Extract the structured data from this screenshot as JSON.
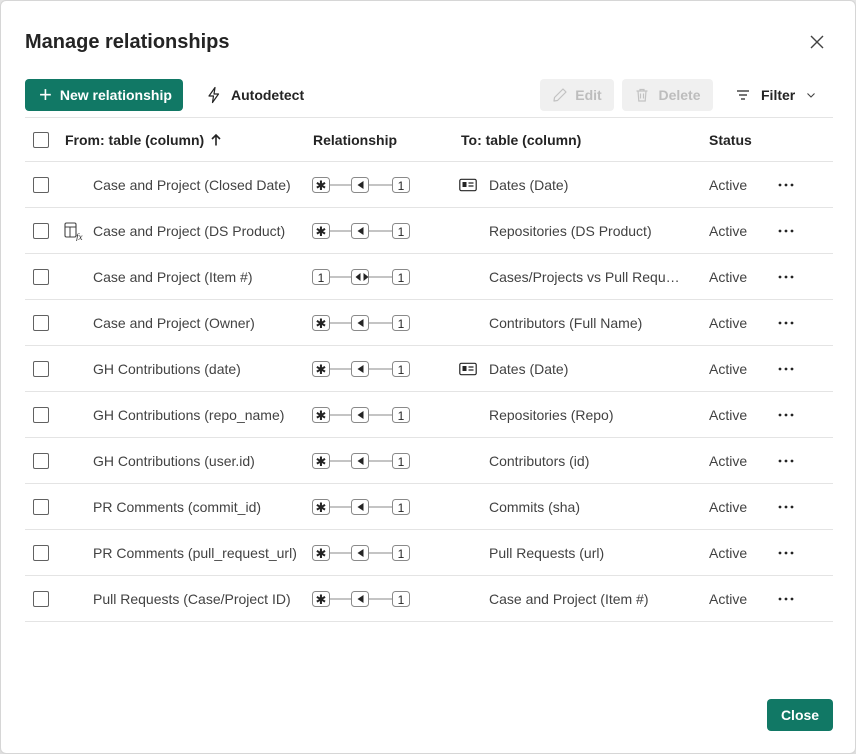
{
  "dialog": {
    "title": "Manage relationships",
    "close_button": "Close"
  },
  "toolbar": {
    "new_relationship": "New relationship",
    "autodetect": "Autodetect",
    "edit": "Edit",
    "delete": "Delete",
    "filter": "Filter"
  },
  "table": {
    "headers": {
      "from": "From: table (column)",
      "relationship": "Relationship",
      "to": "To: table (column)",
      "status": "Status"
    },
    "sort_direction": "ascending",
    "rows": [
      {
        "from": "Case and Project (Closed Date)",
        "from_icon": "",
        "cardinality": [
          "many",
          "one"
        ],
        "direction": "single",
        "to_icon": "date-table-icon",
        "to": "Dates (Date)",
        "status": "Active"
      },
      {
        "from": "Case and Project (DS Product)",
        "from_icon": "calculated-table-icon",
        "cardinality": [
          "many",
          "one"
        ],
        "direction": "single",
        "to_icon": "",
        "to": "Repositories (DS Product)",
        "status": "Active"
      },
      {
        "from": "Case and Project (Item #)",
        "from_icon": "",
        "cardinality": [
          "one",
          "one"
        ],
        "direction": "both",
        "to_icon": "",
        "to": "Cases/Projects vs Pull Requests (Item #)",
        "status": "Active"
      },
      {
        "from": "Case and Project (Owner)",
        "from_icon": "",
        "cardinality": [
          "many",
          "one"
        ],
        "direction": "single",
        "to_icon": "",
        "to": "Contributors (Full Name)",
        "status": "Active"
      },
      {
        "from": "GH Contributions (date)",
        "from_icon": "",
        "cardinality": [
          "many",
          "one"
        ],
        "direction": "single",
        "to_icon": "date-table-icon",
        "to": "Dates (Date)",
        "status": "Active"
      },
      {
        "from": "GH Contributions (repo_name)",
        "from_icon": "",
        "cardinality": [
          "many",
          "one"
        ],
        "direction": "single",
        "to_icon": "",
        "to": "Repositories (Repo)",
        "status": "Active"
      },
      {
        "from": "GH Contributions (user.id)",
        "from_icon": "",
        "cardinality": [
          "many",
          "one"
        ],
        "direction": "single",
        "to_icon": "",
        "to": "Contributors (id)",
        "status": "Active"
      },
      {
        "from": "PR Comments (commit_id)",
        "from_icon": "",
        "cardinality": [
          "many",
          "one"
        ],
        "direction": "single",
        "to_icon": "",
        "to": "Commits (sha)",
        "status": "Active"
      },
      {
        "from": "PR Comments (pull_request_url)",
        "from_icon": "",
        "cardinality": [
          "many",
          "one"
        ],
        "direction": "single",
        "to_icon": "",
        "to": "Pull Requests (url)",
        "status": "Active"
      },
      {
        "from": "Pull Requests (Case/Project ID)",
        "from_icon": "",
        "cardinality": [
          "many",
          "one"
        ],
        "direction": "single",
        "to_icon": "",
        "to": "Case and Project (Item #)",
        "status": "Active"
      }
    ]
  },
  "colors": {
    "accent": "#117865",
    "border": "#e4e4e4",
    "disabled_text": "#bdbdbd",
    "disabled_bg": "#f0f0f0"
  }
}
